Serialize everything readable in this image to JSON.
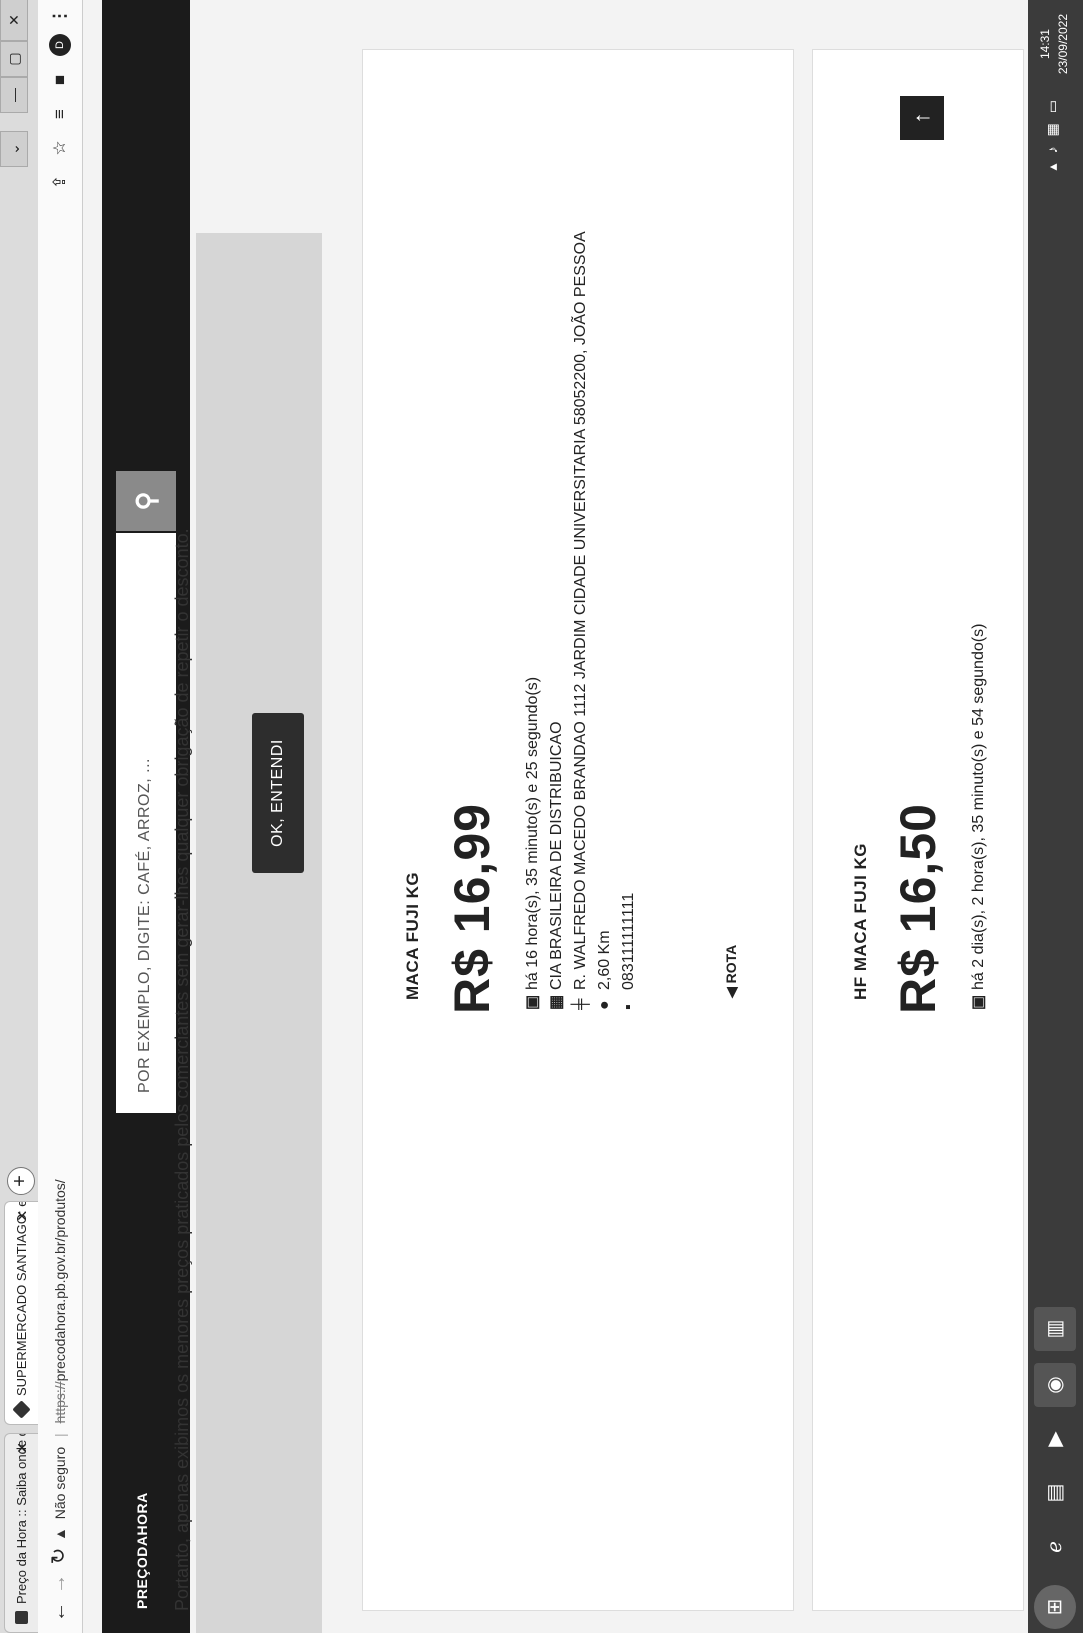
{
  "browser": {
    "tabs": [
      {
        "title": "Preço da Hora :: Saiba onde com",
        "close": "✕"
      },
      {
        "title": "SUPERMERCADO SANTIAGO: em",
        "close": "✕"
      }
    ],
    "new_tab": "+",
    "window_buttons": [
      "—",
      "▢",
      "✕"
    ],
    "nav": {
      "back": "←",
      "forward": "→",
      "reload": "↻"
    },
    "security_label": "Não seguro",
    "url_scheme": "https://",
    "url_rest": "precodahora.pb.gov.br/produtos/",
    "profile_initial": "D",
    "toolbar_icons": [
      "share-icon",
      "star-icon",
      "extensions-icon",
      "sidepanel-icon",
      "menu-icon"
    ]
  },
  "site": {
    "logo": "PREÇODAHORA",
    "search_placeholder": "POR EXEMPLO, DIGITE: CAFÉ, ARROZ, ...",
    "notice": "Portanto, apenas exibimos os menores preços praticados pelos comerciantes sem gerar-lhes qualquer obrigação de repetir o desconto.",
    "ok_button": "OK, ENTENDI"
  },
  "products": [
    {
      "name": "MACA FUJI KG",
      "price": "R$ 16,99",
      "time": "há 16 hora(s), 35 minuto(s) e 25 segundo(s)",
      "store": "CIA BRASILEIRA DE DISTRIBUICAO",
      "address": "R. WALFREDO MACEDO BRANDAO 1112 JARDIM CIDADE UNIVERSITARIA 58052200, JOÃO PESSOA",
      "distance": "2,60 Km",
      "phone": "083111111111",
      "route": "ROTA"
    },
    {
      "name": "HF MACA FUJI KG",
      "price": "R$ 16,50",
      "time": "há 2 dia(s), 2 hora(s), 35 minuto(s) e 54 segundo(s)"
    }
  ],
  "taskbar": {
    "clock_time": "14:31",
    "clock_date": "23/09/2022"
  }
}
